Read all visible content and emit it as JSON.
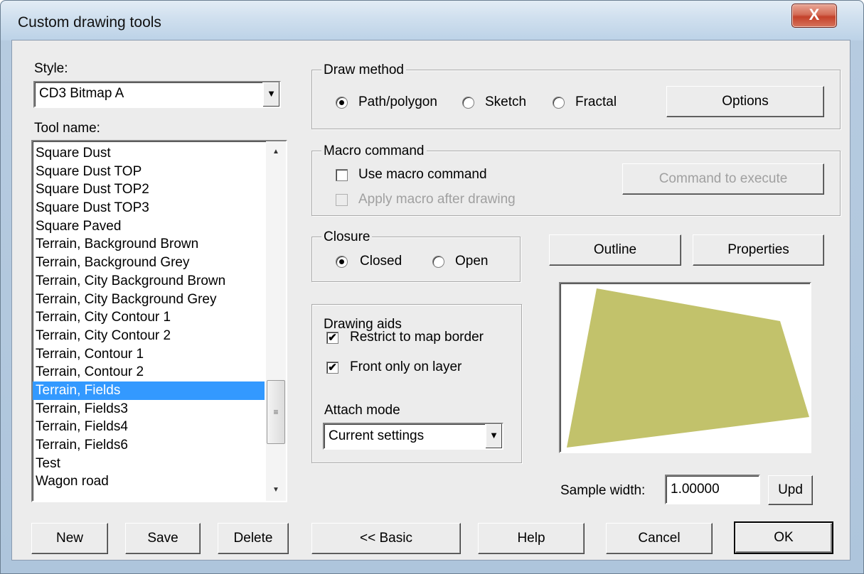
{
  "window": {
    "title": "Custom drawing tools",
    "close_glyph": "X"
  },
  "style": {
    "label": "Style:",
    "value": "CD3 Bitmap A"
  },
  "toolname": {
    "label": "Tool name:",
    "items": [
      "Square Dust",
      "Square Dust TOP",
      "Square Dust TOP2",
      "Square Dust TOP3",
      "Square Paved",
      "Terrain, Background Brown",
      "Terrain, Background Grey",
      "Terrain, City Background Brown",
      "Terrain, City Background Grey",
      "Terrain, City Contour 1",
      "Terrain, City Contour 2",
      "Terrain, Contour 1",
      "Terrain, Contour 2",
      "Terrain, Fields",
      "Terrain, Fields3",
      "Terrain, Fields4",
      "Terrain, Fields6",
      "Test",
      "Wagon road"
    ],
    "selected_index": 13
  },
  "draw_method": {
    "title": "Draw method",
    "options": [
      "Path/polygon",
      "Sketch",
      "Fractal"
    ],
    "selected": 0,
    "options_button": "Options"
  },
  "macro": {
    "title": "Macro command",
    "use_macro": "Use macro command",
    "apply_after": "Apply macro after drawing",
    "command_button": "Command to execute"
  },
  "closure": {
    "title": "Closure",
    "closed": "Closed",
    "open": "Open",
    "selected": "closed"
  },
  "drawing_aids": {
    "title": "Drawing aids",
    "restrict": "Restrict to map border",
    "front": "Front only on layer",
    "check_glyph": "✔",
    "attach_label": "Attach mode",
    "attach_value": "Current settings"
  },
  "preview": {
    "fill_color": "#c2c26b"
  },
  "buttons": {
    "outline": "Outline",
    "properties": "Properties",
    "sample_width_label": "Sample width:",
    "sample_width_value": "1.00000",
    "upd": "Upd",
    "new": "New",
    "save": "Save",
    "delete": "Delete",
    "basic": "<< Basic",
    "help": "Help",
    "cancel": "Cancel",
    "ok": "OK"
  }
}
